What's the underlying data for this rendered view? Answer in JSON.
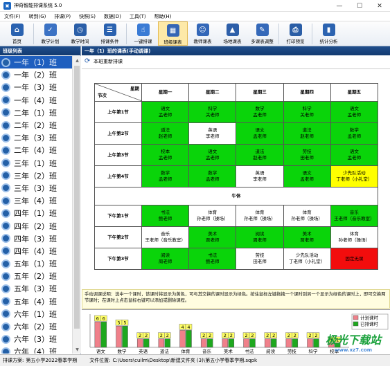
{
  "window": {
    "title": "神奇智能排课系统 5.0"
  },
  "menu": [
    "文件(F)",
    "转到(G)",
    "排课(P)",
    "快照(S)",
    "数据(D)",
    "工具(T)",
    "帮助(H)"
  ],
  "toolbar": [
    {
      "label": "首页",
      "icon": "home-icon",
      "color": "#2a62b0",
      "glyph": "⌂"
    },
    {
      "label": "教学计划",
      "icon": "clipboard-icon",
      "color": "#3b72c4",
      "glyph": "✓"
    },
    {
      "label": "教学时间",
      "icon": "clock-icon",
      "color": "#2b5fa8",
      "glyph": "◷"
    },
    {
      "label": "排课条件",
      "icon": "checklist-icon",
      "color": "#2a62b0",
      "glyph": "☰"
    },
    {
      "label": "一键排课",
      "icon": "hand-click-icon",
      "color": "#3a7bd5",
      "glyph": "☝"
    },
    {
      "label": "班级课表",
      "icon": "calendar-grid-icon",
      "color": "#3565b5",
      "glyph": "▦",
      "selected": true
    },
    {
      "label": "教师课表",
      "icon": "teacher-icon",
      "color": "#3367b8",
      "glyph": "☺"
    },
    {
      "label": "场地课表",
      "icon": "building-icon",
      "color": "#2d5fa9",
      "glyph": "▲"
    },
    {
      "label": "多课表调整",
      "icon": "adjust-icon",
      "color": "#3569b9",
      "glyph": "✎"
    },
    {
      "label": "打印预览",
      "icon": "printer-icon",
      "color": "#2b5ea6",
      "glyph": "⎙"
    },
    {
      "label": "统计分析",
      "icon": "bar-chart-icon",
      "color": "#2c63b0",
      "glyph": "▮"
    }
  ],
  "left_panel": {
    "header": "班级列表"
  },
  "classes": [
    "一年（1）班",
    "一年（2）班",
    "一年（3）班",
    "一年（4）班",
    "二年（1）班",
    "二年（2）班",
    "二年（3）班",
    "二年（4）班",
    "三年（1）班",
    "三年（2）班",
    "三年（3）班",
    "三年（4）班",
    "四年（1）班",
    "四年（2）班",
    "四年（3）班",
    "四年（4）班",
    "五年（1）班",
    "五年（2）班",
    "五年（3）班",
    "五年（4）班",
    "六年（1）班",
    "六年（2）班",
    "六年（3）班",
    "六年（4）班"
  ],
  "selected_class_index": 0,
  "main": {
    "header": "一年（1）班的课表(手动调课)",
    "new_schedule": "本班重新排课",
    "corner_top": "星期",
    "corner_bottom": "节次",
    "days": [
      "星期一",
      "星期二",
      "星期三",
      "星期四",
      "星期五"
    ],
    "noon_label": "午休",
    "morning": [
      {
        "period": "上午第1节",
        "cells": [
          {
            "l1": "语文",
            "l2": "孟老师",
            "c": "g"
          },
          {
            "l1": "科学",
            "l2": "关老师",
            "c": "g"
          },
          {
            "l1": "数学",
            "l2": "孟老师",
            "c": "g"
          },
          {
            "l1": "科学",
            "l2": "关老师",
            "c": "g"
          },
          {
            "l1": "语文",
            "l2": "孟老师",
            "c": "g"
          }
        ]
      },
      {
        "period": "上午第2节",
        "cells": [
          {
            "l1": "道法",
            "l2": "赵老师",
            "c": "g"
          },
          {
            "l1": "英语",
            "l2": "李老师",
            "c": "w"
          },
          {
            "l1": "语文",
            "l2": "孟老师",
            "c": "g"
          },
          {
            "l1": "道法",
            "l2": "赵老师",
            "c": "g"
          },
          {
            "l1": "数学",
            "l2": "孟老师",
            "c": "g"
          }
        ]
      },
      {
        "period": "上午第3节",
        "cells": [
          {
            "l1": "校本",
            "l2": "孟老师",
            "c": "g"
          },
          {
            "l1": "语文",
            "l2": "孟老师",
            "c": "g"
          },
          {
            "l1": "道法",
            "l2": "赵老师",
            "c": "g"
          },
          {
            "l1": "劳技",
            "l2": "田老师",
            "c": "g"
          },
          {
            "l1": "语文",
            "l2": "孟老师",
            "c": "g"
          }
        ]
      },
      {
        "period": "上午第4节",
        "cells": [
          {
            "l1": "数学",
            "l2": "孟老师",
            "c": "g"
          },
          {
            "l1": "数学",
            "l2": "孟老师",
            "c": "g"
          },
          {
            "l1": "英语",
            "l2": "李老师",
            "c": "w"
          },
          {
            "l1": "语文",
            "l2": "孟老师",
            "c": "g"
          },
          {
            "l1": "少先队活动",
            "l2": "丁老师（小礼堂）",
            "c": "y"
          }
        ]
      }
    ],
    "afternoon": [
      {
        "period": "下午第1节",
        "cells": [
          {
            "l1": "书法",
            "l2": "鲍老师",
            "c": "g"
          },
          {
            "l1": "体育",
            "l2": "孙老师（操场）",
            "c": "w"
          },
          {
            "l1": "体育",
            "l2": "孙老师（操场）",
            "c": "w"
          },
          {
            "l1": "体育",
            "l2": "孙老师（操场）",
            "c": "w"
          },
          {
            "l1": "音乐",
            "l2": "王老师（音乐教室）",
            "c": "g"
          }
        ]
      },
      {
        "period": "下午第2节",
        "cells": [
          {
            "l1": "音乐",
            "l2": "王老师（音乐教室）",
            "c": "w"
          },
          {
            "l1": "美术",
            "l2": "贾老师",
            "c": "g"
          },
          {
            "l1": "阅读",
            "l2": "周老师",
            "c": "g"
          },
          {
            "l1": "美术",
            "l2": "贾老师",
            "c": "g"
          },
          {
            "l1": "体育",
            "l2": "孙老师（操场）",
            "c": "w"
          }
        ]
      },
      {
        "period": "下午第3节",
        "cells": [
          {
            "l1": "阅读",
            "l2": "周老师",
            "c": "g"
          },
          {
            "l1": "书法",
            "l2": "鲍老师",
            "c": "g"
          },
          {
            "l1": "劳技",
            "l2": "田老师",
            "c": "w"
          },
          {
            "l1": "少先队活动",
            "l2": "丁老师（小礼堂）",
            "c": "w"
          },
          {
            "l1": "固定无课",
            "l2": "",
            "c": "r"
          }
        ]
      }
    ],
    "hint": "手动调课说明：选中一个课时，该课时将显示为黄色，可与其交换的课时显示为绿色。按住鼠标左键拖拽一个课时到另一个显示为绿色的课时上，即可交换两节课时；在课时上点击鼠标右键可以添加或删除课程。"
  },
  "colors": {
    "green": "#0ad40a",
    "yellow": "#ffff00",
    "red": "#f20d0d",
    "header_blue": "#1f4e8c"
  },
  "chart_data": {
    "type": "bar",
    "categories": [
      "语文",
      "数学",
      "英语",
      "道法",
      "体育",
      "音乐",
      "美术",
      "书法",
      "阅读",
      "劳技",
      "科学",
      "校本"
    ],
    "series": [
      {
        "name": "计划课时",
        "values": [
          6,
          5,
          2,
          2,
          4,
          2,
          2,
          2,
          2,
          2,
          2,
          1
        ]
      },
      {
        "name": "已排课时",
        "values": [
          6,
          5,
          2,
          2,
          4,
          2,
          2,
          2,
          2,
          2,
          2,
          1
        ]
      }
    ],
    "value_labels": [
      [
        "6",
        "6"
      ],
      [
        "5",
        "5"
      ],
      [
        "2",
        "2"
      ],
      [
        "2",
        "2"
      ],
      [
        "4",
        "4"
      ],
      [
        "2",
        "2"
      ],
      [
        "2",
        "2"
      ],
      [
        "2",
        "2"
      ],
      [
        "2",
        "2"
      ],
      [
        "2",
        "2"
      ],
      [
        "2",
        "2"
      ],
      [
        "1",
        "1"
      ]
    ],
    "legend_position": "right",
    "colors": [
      "#f0808a",
      "#1ea81e"
    ]
  },
  "status": {
    "scheme_label": "排课方案:",
    "scheme": "第五小学2022春季学期",
    "file_label": "文件位置:",
    "file": "C:\\Users\\cuilm\\Desktop\\新建文件夹 (3)\\第五小学春季学期.sqpk"
  },
  "watermark": {
    "text": "极光下载站",
    "url": "www.xz7.com"
  }
}
